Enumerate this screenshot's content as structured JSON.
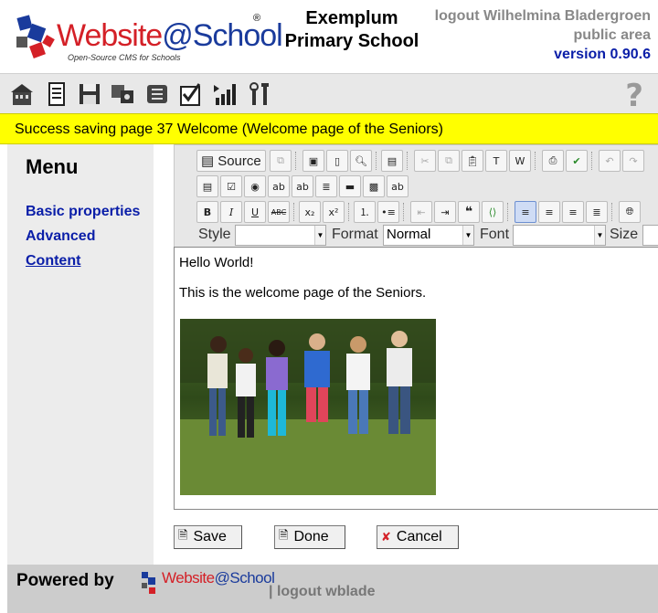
{
  "header": {
    "logo_word": "Website",
    "logo_at": "@School",
    "logo_tagline": "Open-Source CMS for Schools",
    "school_line1": "Exemplum",
    "school_line2": "Primary School",
    "logout_link": "logout",
    "user_name": "Wilhelmina Bladergroen",
    "area": "public area",
    "version": "version 0.90.6"
  },
  "toolbar": {
    "icons": [
      "home-icon",
      "page-icon",
      "floppy-icon",
      "modules-icon",
      "users-icon",
      "checklist-icon",
      "statistics-icon",
      "tools-icon"
    ],
    "help_icon": "?"
  },
  "message": "Success saving page 37 Welcome (Welcome page of the Seniors)",
  "sidebar": {
    "title": "Menu",
    "items": [
      {
        "label": "Basic properties"
      },
      {
        "label": "Advanced"
      },
      {
        "label": "Content"
      }
    ]
  },
  "editor": {
    "source_label": "Source",
    "style_label": "Style",
    "style_value": "",
    "format_label": "Format",
    "format_value": "Normal",
    "font_label": "Font",
    "font_value": "",
    "size_label": "Size",
    "paragraph1": "Hello World!",
    "paragraph2": "This is the welcome page of the Seniors."
  },
  "buttons": {
    "save": "Save",
    "done": "Done",
    "cancel": "Cancel"
  },
  "footer": {
    "powered_by": "Powered by",
    "logo_word": "Website",
    "logo_at": "@School",
    "separator": "|",
    "logout": "logout wblade"
  },
  "colors": {
    "message_bg": "#ffff00",
    "link": "#0a1ea8",
    "brand_red": "#d42027",
    "brand_blue": "#1a3b9c"
  }
}
